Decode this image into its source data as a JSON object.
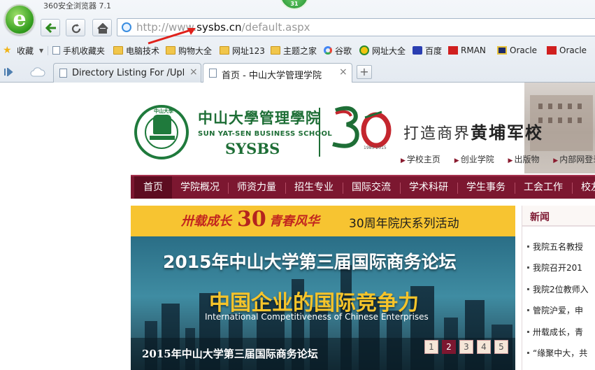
{
  "browser": {
    "title": "360安全浏览器 7.1",
    "badge": "31",
    "url_prefix": "http://www.",
    "url_domain": "sysbs.cn",
    "url_suffix": "/default.aspx",
    "bookmarks": [
      {
        "label": "收藏",
        "icon": "star-icon"
      },
      {
        "label": "手机收藏夹",
        "icon": "page-icon"
      },
      {
        "label": "电脑技术",
        "icon": "folder-icon"
      },
      {
        "label": "购物大全",
        "icon": "folder-icon"
      },
      {
        "label": "网址123",
        "icon": "folder-icon"
      },
      {
        "label": "主题之家",
        "icon": "folder-icon"
      },
      {
        "label": "谷歌",
        "icon": "google-icon"
      },
      {
        "label": "网址大全",
        "icon": "site-icon"
      },
      {
        "label": "百度",
        "icon": "baidu-icon"
      },
      {
        "label": "RMAN",
        "icon": "red-c-icon"
      },
      {
        "label": "Oracle",
        "icon": "oracle-icon"
      },
      {
        "label": "Oracle",
        "icon": "red-c-icon"
      }
    ],
    "tabs": [
      {
        "title": "Directory Listing For /Uplo",
        "active": false
      },
      {
        "title": "首页 - 中山大学管理学院",
        "active": true
      }
    ],
    "close_glyph": "×",
    "newtab_glyph": "+"
  },
  "header": {
    "seal_text": "中山大學",
    "school_cn": "中山大學管理學院",
    "school_en": "SUN YAT-SEN BUSINESS SCHOOL",
    "school_abbr": "SYSBS",
    "anniv_years": "1985-2015",
    "slogan_prefix": "打造商界",
    "slogan_main": "黄埔军校",
    "top_links": [
      "学校主页",
      "创业学院",
      "出版物",
      "内部网登录"
    ]
  },
  "nav": {
    "items": [
      "首页",
      "学院概况",
      "师资力量",
      "招生专业",
      "国际交流",
      "学术科研",
      "学生事务",
      "工会工作",
      "校友"
    ]
  },
  "banner": {
    "calli_left": "卅载成长",
    "calli_30": "30",
    "calli_right": "青春风华",
    "activity": "30周年院庆系列活动",
    "forum_title": "2015年中山大学第三届国际商务论坛",
    "forum_sub": "中国企业的国际竞争力",
    "forum_en": "International Competitiveness of Chinese Enterprises",
    "caption": "2015年中山大学第三届国际商务论坛",
    "pages": [
      "1",
      "2",
      "3",
      "4",
      "5"
    ],
    "current_page": "2"
  },
  "news": {
    "heading": "新闻",
    "items": [
      "我院五名教授",
      "我院召开201",
      "我院2位教师入",
      "管院沪爱，申",
      "卅载成长，青",
      "“缘聚中大，共"
    ]
  },
  "colors": {
    "nav_bg": "#7c1730",
    "school_green": "#1e6e36",
    "banner_yellow": "#f7c431",
    "accent_gold": "#f6c42a"
  }
}
